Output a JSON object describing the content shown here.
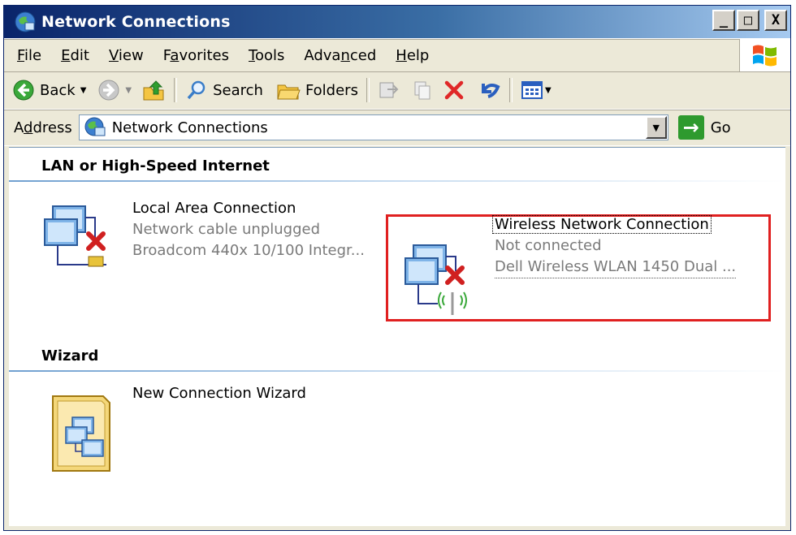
{
  "window": {
    "title": "Network Connections",
    "controls": {
      "minimize": "_",
      "maximize": "□",
      "close": "X"
    }
  },
  "menu": {
    "items": [
      {
        "label": "File",
        "accel_prefix": "",
        "accel": "F",
        "rest": "ile"
      },
      {
        "label": "Edit",
        "accel_prefix": "",
        "accel": "E",
        "rest": "dit"
      },
      {
        "label": "View",
        "accel_prefix": "",
        "accel": "V",
        "rest": "iew"
      },
      {
        "label": "Favorites",
        "accel_prefix": "F",
        "accel": "a",
        "rest": "vorites"
      },
      {
        "label": "Tools",
        "accel_prefix": "",
        "accel": "T",
        "rest": "ools"
      },
      {
        "label": "Advanced",
        "accel_prefix": "Adva",
        "accel": "n",
        "rest": "ced"
      },
      {
        "label": "Help",
        "accel_prefix": "",
        "accel": "H",
        "rest": "elp"
      }
    ]
  },
  "toolbar": {
    "back_label": "Back",
    "search_label": "Search",
    "folders_label": "Folders"
  },
  "address": {
    "label": "Address",
    "label_accel_prefix": "A",
    "label_accel": "d",
    "label_rest": "dress",
    "value": "Network Connections",
    "go_label": "Go"
  },
  "groups": {
    "lan": {
      "header": "LAN or High-Speed Internet",
      "items": [
        {
          "name": "Local Area Connection",
          "status": "Network cable unplugged",
          "device": "Broadcom 440x 10/100 Integr..."
        },
        {
          "name": "Wireless Network Connection",
          "status": "Not connected",
          "device": "Dell Wireless WLAN 1450 Dual ..."
        }
      ]
    },
    "wizard": {
      "header": "Wizard",
      "items": [
        {
          "name": "New Connection Wizard"
        }
      ]
    }
  },
  "colors": {
    "highlight": "#e02020",
    "title_gradient_start": "#0a246a",
    "status_text": "#7a7a7a"
  }
}
